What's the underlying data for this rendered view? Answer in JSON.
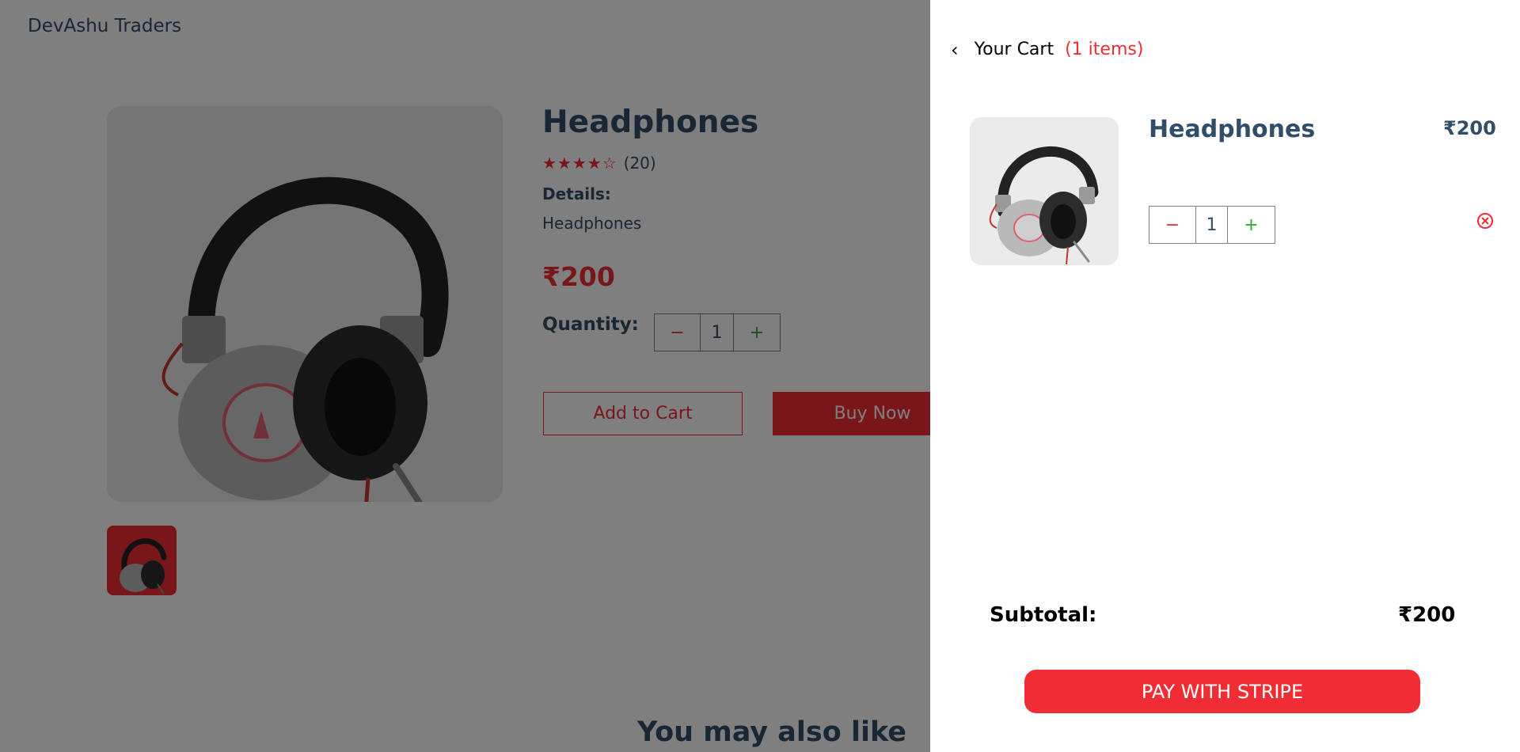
{
  "header": {
    "brand": "DevAshu Traders"
  },
  "product": {
    "title": "Headphones",
    "stars_filled": 4,
    "stars_total": 5,
    "stars_display": "★★★★☆",
    "review_count": "(20)",
    "details_label": "Details:",
    "details_text": "Headphones",
    "price": "₹200",
    "quantity_label": "Quantity:",
    "quantity": {
      "minus": "−",
      "value": "1",
      "plus": "+"
    },
    "add_to_cart": "Add to Cart",
    "buy_now": "Buy Now",
    "main_image_icon": "headphones-product-image",
    "thumbnail_icon": "headphones-thumbnail"
  },
  "also_like": {
    "heading": "You may also like"
  },
  "cart": {
    "back_icon": "chevron-left-icon",
    "back_glyph": "‹",
    "title": "Your Cart",
    "items_count": "(1 items)",
    "items": [
      {
        "name": "Headphones",
        "price": "₹200",
        "quantity": {
          "minus": "−",
          "value": "1",
          "plus": "+"
        },
        "remove_icon": "remove-circle-icon"
      }
    ],
    "subtotal_label": "Subtotal:",
    "subtotal_value": "₹200",
    "pay_button": "PAY WITH STRIPE"
  },
  "colors": {
    "accent": "#f02d34",
    "text_dark": "#324d67",
    "plus_green": "#31a831",
    "overlay": "rgba(0,0,0,0.5)",
    "image_bg": "#ebebeb"
  }
}
